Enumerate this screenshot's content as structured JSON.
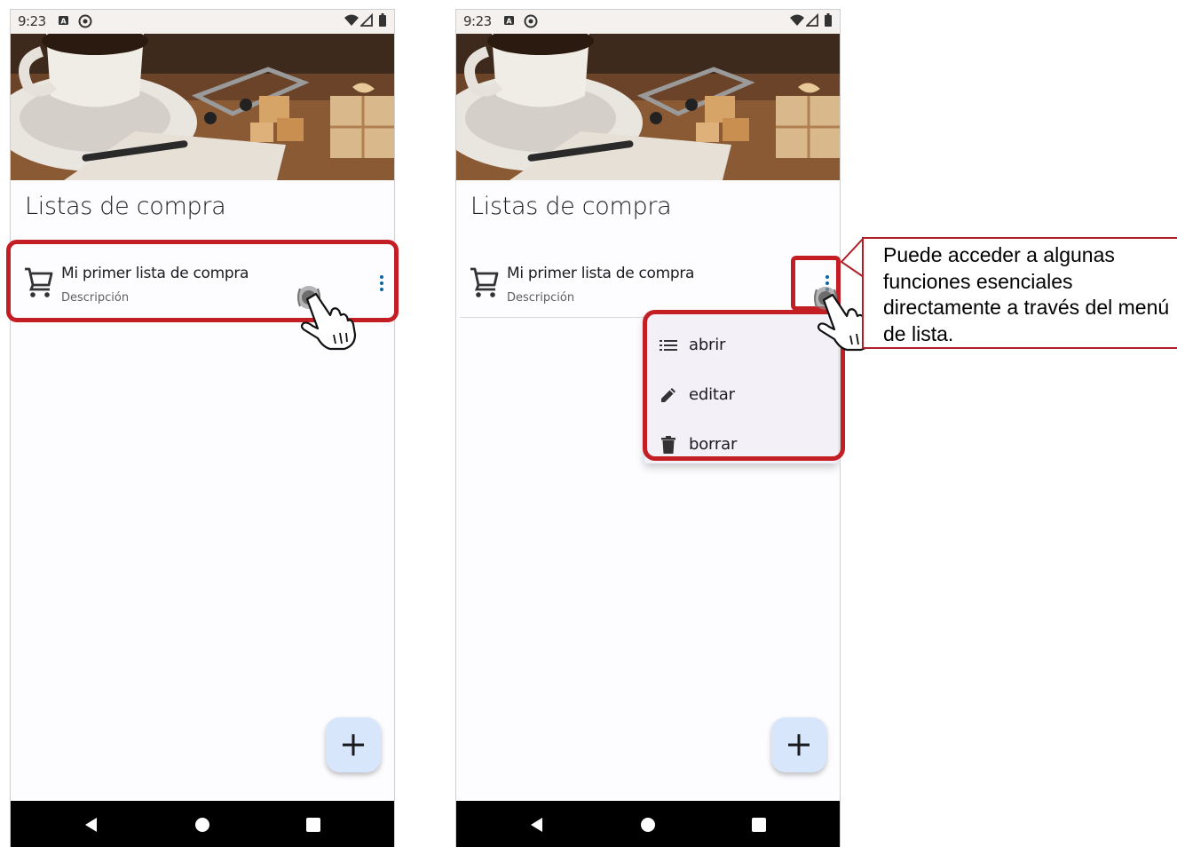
{
  "status": {
    "time": "9:23"
  },
  "page": {
    "title": "Listas de compra"
  },
  "list_item": {
    "title": "Mi primer lista de compra",
    "subtitle": "Descripción"
  },
  "menu": {
    "items": [
      {
        "label": "abrir",
        "icon": "list-icon"
      },
      {
        "label": "editar",
        "icon": "pencil-icon"
      },
      {
        "label": "borrar",
        "icon": "trash-icon"
      }
    ]
  },
  "fab": {
    "icon": "plus-icon"
  },
  "callout": {
    "text": "Puede acceder a algunas funciones esenciales directamente a través del menú de lista."
  },
  "colors": {
    "highlight": "#c41e25",
    "accent": "#0b67a4",
    "fab_background": "#d7e6fb"
  }
}
